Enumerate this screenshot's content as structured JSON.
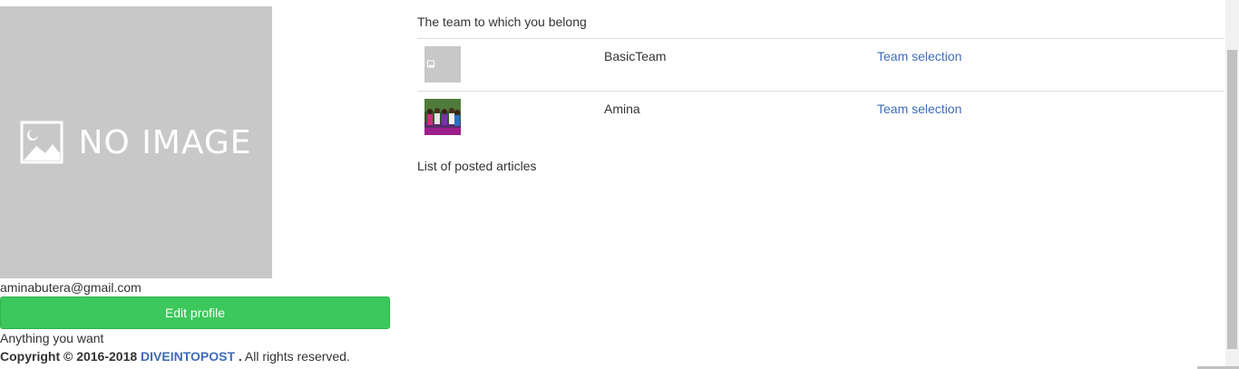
{
  "profile": {
    "image_placeholder_text": "NO IMAGE",
    "email": "aminabutera@gmail.com",
    "edit_button_label": "Edit profile",
    "bio": "Anything you want"
  },
  "footer": {
    "copyright_prefix": "Copyright © 2016-2018",
    "brand": "DIVEINTOPOST",
    "brand_suffix": " .",
    "rights": " All rights reserved."
  },
  "teams": {
    "title": "The team to which you belong",
    "rows": [
      {
        "name": "BasicTeam",
        "action": "Team selection",
        "thumb_label": "NO IMAGE"
      },
      {
        "name": "Amina",
        "action": "Team selection"
      }
    ]
  },
  "articles": {
    "title": "List of posted articles"
  },
  "colors": {
    "primary_button": "#3cc85c",
    "link": "#3f6cb7",
    "placeholder_bg": "#c8c8c8"
  }
}
